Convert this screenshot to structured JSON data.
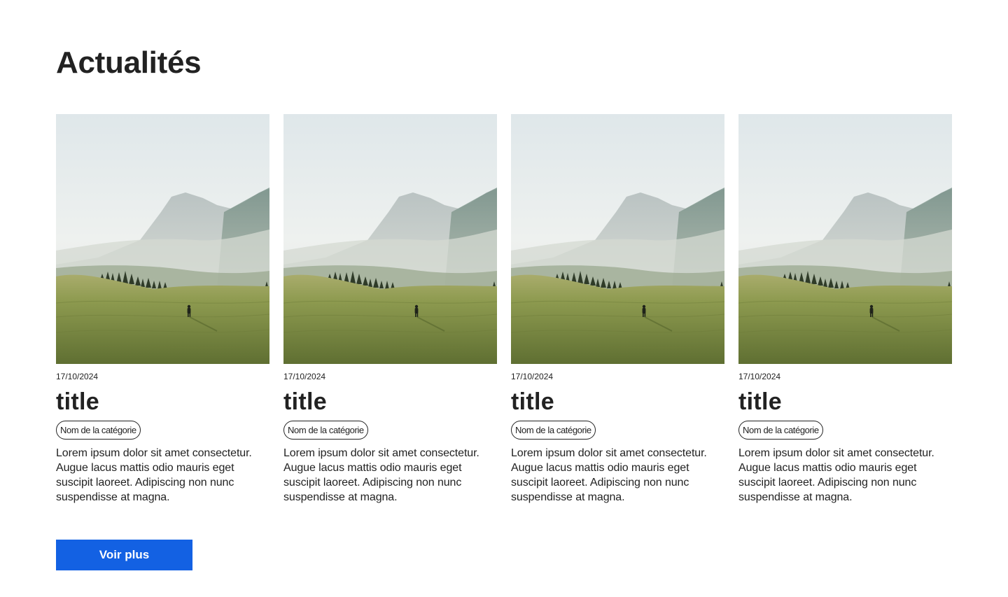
{
  "section": {
    "title": "Actualités"
  },
  "cards": [
    {
      "date": "17/10/2024",
      "title": "title",
      "category": "Nom de la catégorie",
      "description": "Lorem ipsum dolor sit amet consectetur. Augue lacus mattis odio mauris eget suscipit laoreet. Adipiscing non nunc suspendisse at magna."
    },
    {
      "date": "17/10/2024",
      "title": "title",
      "category": "Nom de la catégorie",
      "description": "Lorem ipsum dolor sit amet consectetur. Augue lacus mattis odio mauris eget suscipit laoreet. Adipiscing non nunc suspendisse at magna."
    },
    {
      "date": "17/10/2024",
      "title": "title",
      "category": "Nom de la catégorie",
      "description": "Lorem ipsum dolor sit amet consectetur. Augue lacus mattis odio mauris eget suscipit laoreet. Adipiscing non nunc suspendisse at magna."
    },
    {
      "date": "17/10/2024",
      "title": "title",
      "category": "Nom de la catégorie",
      "description": "Lorem ipsum dolor sit amet consectetur. Augue lacus mattis odio mauris eget suscipit laoreet. Adipiscing non nunc suspendisse at magna."
    }
  ],
  "actions": {
    "more_label": "Voir plus"
  },
  "colors": {
    "accent": "#1361e3",
    "text": "#222222",
    "background": "#ffffff"
  }
}
